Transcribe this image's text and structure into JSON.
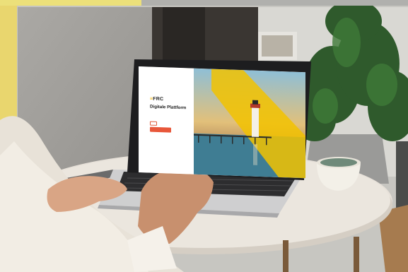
{
  "screen": {
    "logo_mark": "≡",
    "logo_text": "FRC",
    "headline": "Digitale Plattform",
    "subtext": "",
    "checkbox_label": "",
    "cta_label": "",
    "footnote": ""
  },
  "colors": {
    "brand_yellow": "#f2c200",
    "cta_red": "#e8573a",
    "background_wall": "#c9c8c3"
  }
}
